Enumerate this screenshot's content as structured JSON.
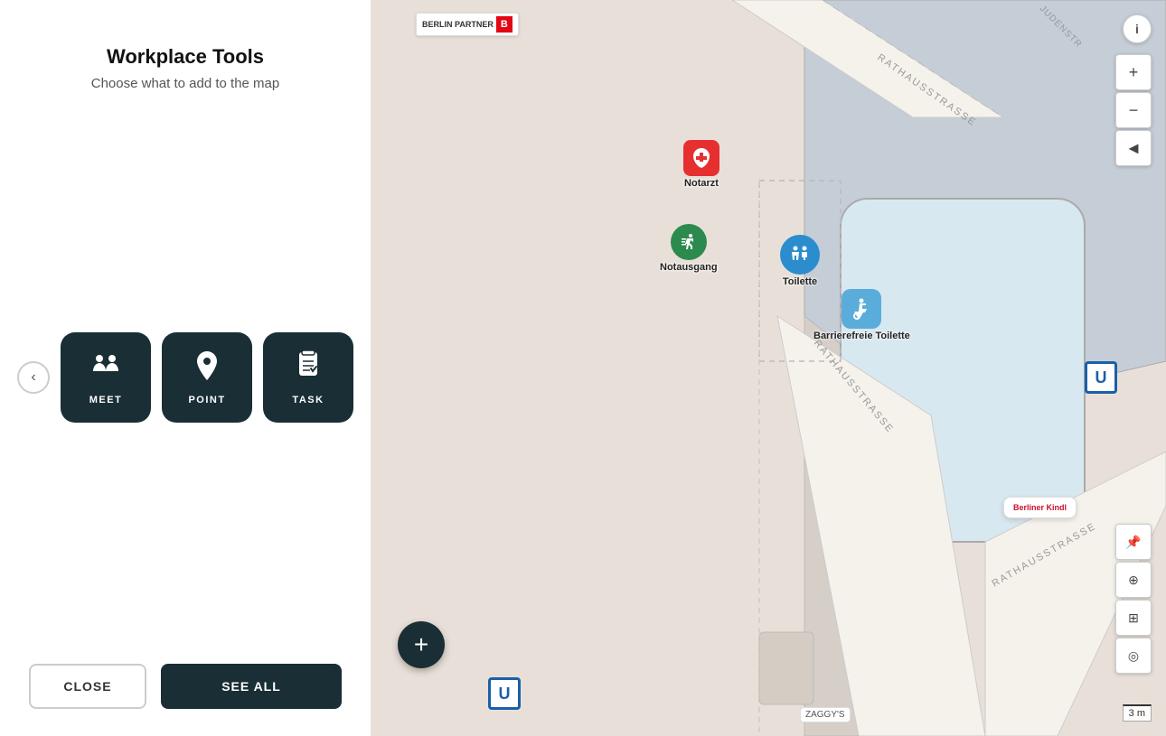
{
  "panel": {
    "title": "Workplace Tools",
    "subtitle": "Choose what to add to the map",
    "close_label": "CLOSE",
    "see_all_label": "SEE ALL",
    "tools": [
      {
        "id": "meet",
        "label": "MEET",
        "icon": "meet"
      },
      {
        "id": "point",
        "label": "POINT",
        "icon": "point"
      },
      {
        "id": "task",
        "label": "TASK",
        "icon": "task"
      }
    ]
  },
  "map": {
    "markers": [
      {
        "id": "notarzt",
        "label": "Notarzt",
        "type": "medical",
        "color": "#e63030"
      },
      {
        "id": "notausgang",
        "label": "Notausgang",
        "type": "exit",
        "color": "#2d8a4e"
      },
      {
        "id": "toilette",
        "label": "Toilette",
        "type": "toilet",
        "color": "#2b8dce"
      },
      {
        "id": "barrierefreie-toilette",
        "label": "Barrierefreie Toilette",
        "type": "accessible-toilet",
        "color": "#5aaddb"
      }
    ],
    "scale_label": "3 m",
    "add_button_label": "+",
    "info_button_label": "i",
    "zoom_in_label": "+",
    "zoom_out_label": "−",
    "reset_label": "◄",
    "berlin_partner": "BERLIN PARTNER",
    "berliner_kindl": "Berliner Kindl",
    "ubahn_label": "U"
  }
}
